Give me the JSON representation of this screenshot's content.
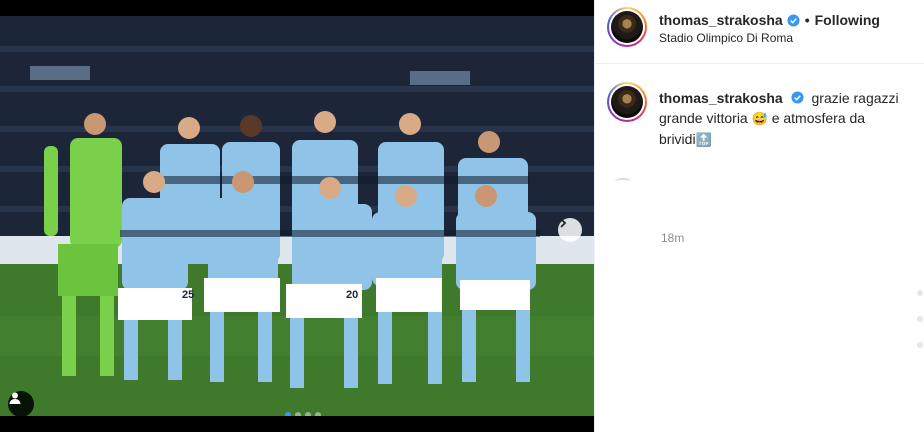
{
  "post": {
    "username": "thomas_strakosha",
    "follow_status": "Following",
    "separator": "•",
    "location": "Stadio Olimpico Di Roma",
    "caption_lines": [
      "grazie ragazzi",
      "grande vittoria",
      "e atmosfera da",
      "brividi"
    ],
    "time_ago": "18m",
    "jersey_numbers": [
      "25",
      "20"
    ],
    "carousel": {
      "count": 4,
      "active_index": 0
    }
  },
  "colors": {
    "verified": "#3897f0",
    "accent": "#3897f0",
    "kit": "#8fc3e8",
    "gk_kit": "#7ad04a",
    "pitch": "#3f7a2c"
  },
  "icons": {
    "user_tag": "user-tag-icon",
    "next": "chevron-right-icon",
    "verified": "verified-badge-icon",
    "emoji": "smiling-face-emoji",
    "top": "top-arrow-emoji"
  }
}
